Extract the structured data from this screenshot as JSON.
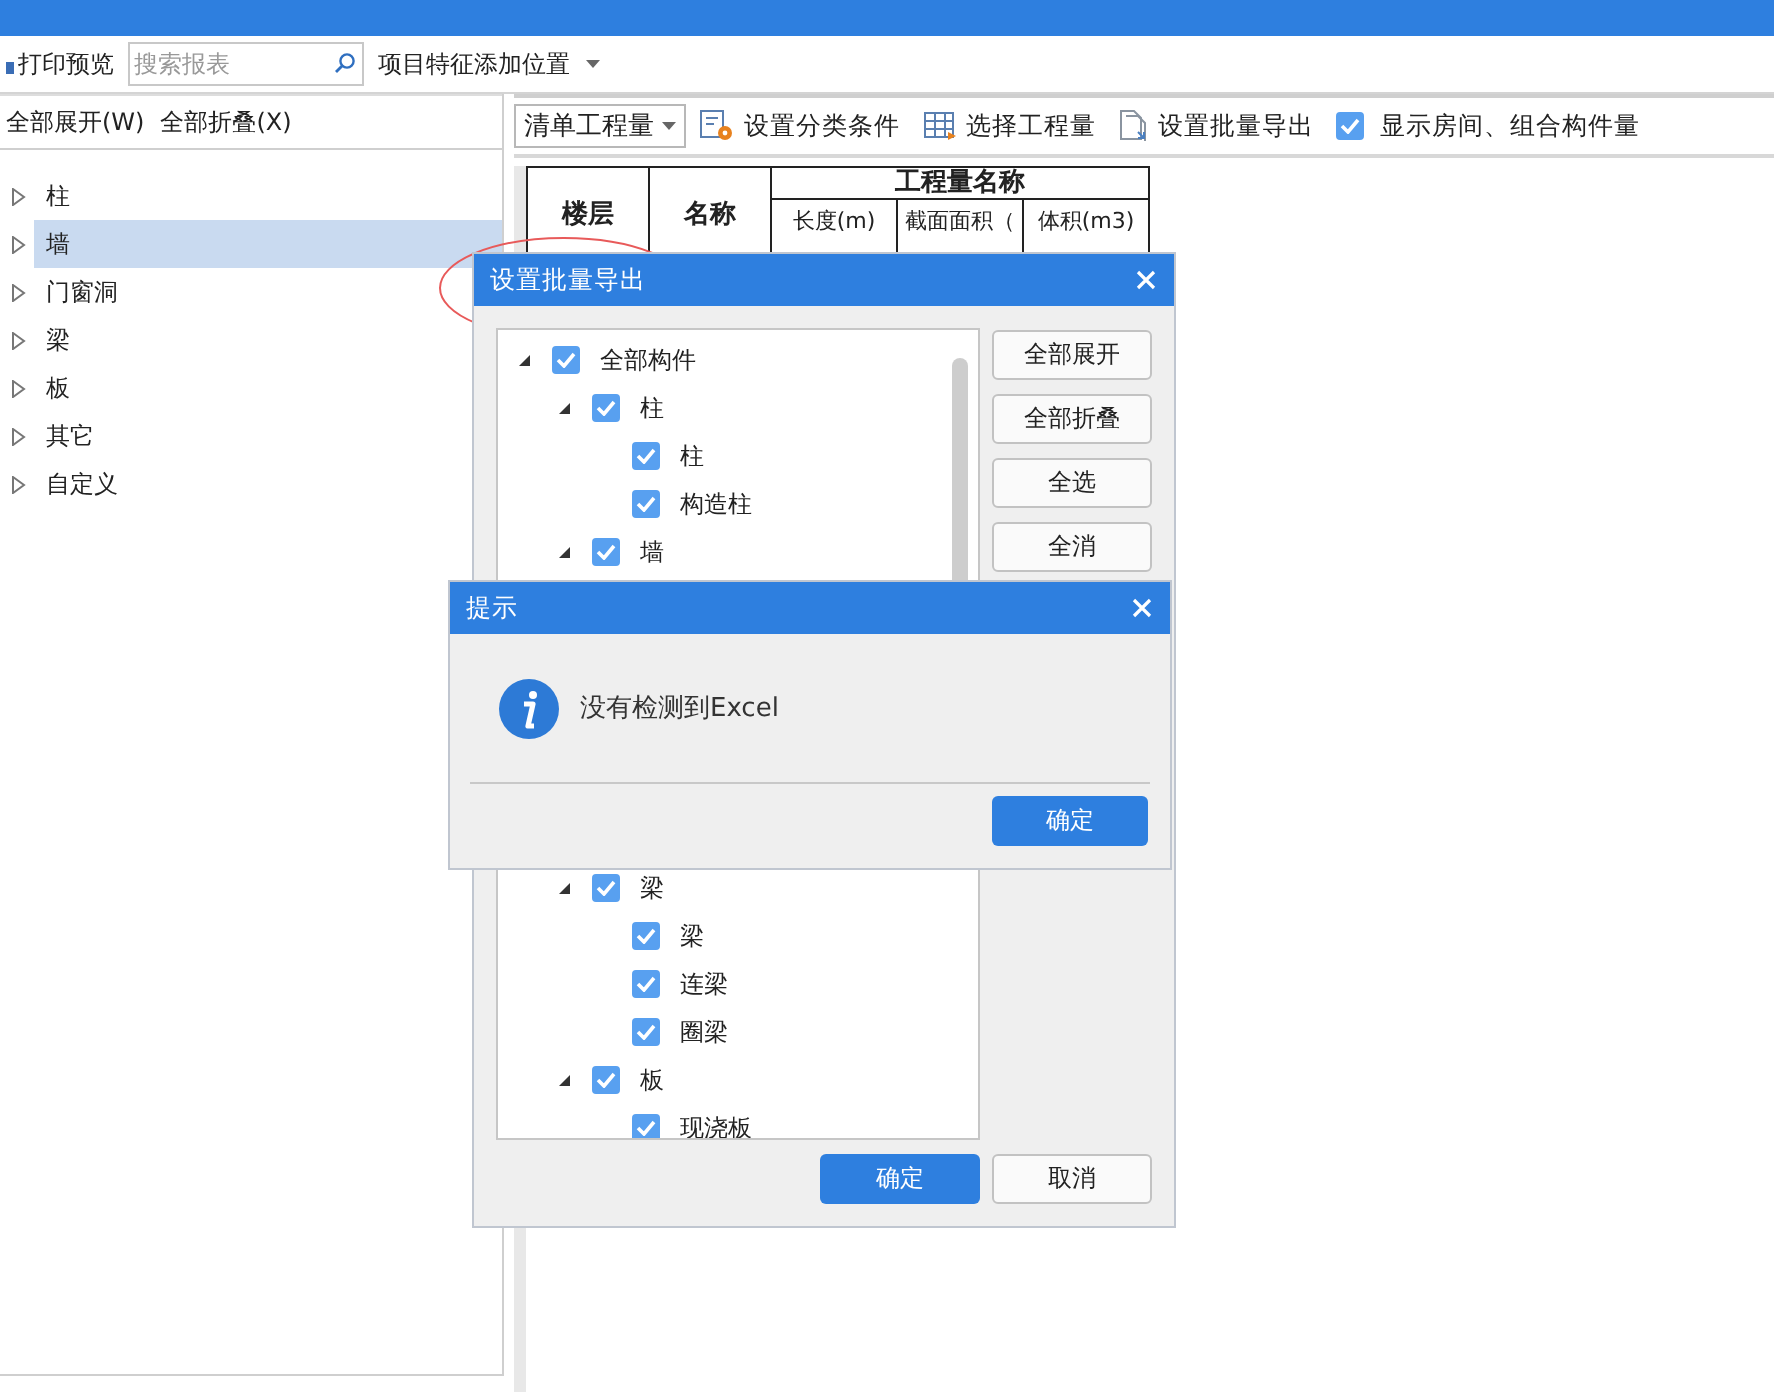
{
  "toolbar": {
    "print_preview": "打印预览",
    "search": {
      "placeholder": "搜索报表"
    },
    "feature_position": "项目特征添加位置"
  },
  "left_panel": {
    "buttons": [
      "全部展开(W)",
      "全部折叠(X)"
    ],
    "tree": [
      {
        "label": "柱",
        "selected": false,
        "expanded": false
      },
      {
        "label": "墙",
        "selected": true,
        "expanded": false
      },
      {
        "label": "门窗洞",
        "selected": false,
        "expanded": false
      },
      {
        "label": "梁",
        "selected": false,
        "expanded": false
      },
      {
        "label": "板",
        "selected": false,
        "expanded": false
      },
      {
        "label": "其它",
        "selected": false,
        "expanded": false
      },
      {
        "label": "自定义",
        "selected": false,
        "expanded": false
      }
    ]
  },
  "report_toolbar": {
    "mode": "清单工程量",
    "actions": [
      {
        "label": "设置分类条件",
        "kind": "classify"
      },
      {
        "label": "选择工程量",
        "kind": "table"
      },
      {
        "label": "设置批量导出",
        "kind": "export"
      }
    ],
    "show_rooms": {
      "label": "显示房间、组合构件量",
      "checked": true
    }
  },
  "table": {
    "floor": "楼层",
    "name": "名称",
    "group": "工程量名称",
    "columns": [
      "长度(m)",
      "截面面积（",
      "体积(m3)"
    ]
  },
  "export_dialog": {
    "title": "设置批量导出",
    "tree": [
      {
        "label": "全部构件",
        "checked": true,
        "expanded": true,
        "children": [
          {
            "label": "柱",
            "checked": true,
            "expanded": true,
            "children": [
              {
                "label": "柱",
                "checked": true
              },
              {
                "label": "构造柱",
                "checked": true
              }
            ]
          },
          {
            "label": "墙",
            "checked": true,
            "expanded": true
          },
          {
            "label": "梁",
            "checked": true,
            "expanded": true,
            "children": [
              {
                "label": "梁",
                "checked": true
              },
              {
                "label": "连梁",
                "checked": true
              },
              {
                "label": "圈梁",
                "checked": true
              }
            ]
          },
          {
            "label": "板",
            "checked": true,
            "expanded": true,
            "children": [
              {
                "label": "现浇板",
                "checked": true
              }
            ]
          }
        ]
      }
    ],
    "side_buttons": [
      "全部展开",
      "全部折叠",
      "全选",
      "全消"
    ],
    "ok": "确定",
    "cancel": "取消"
  },
  "alert": {
    "title": "提示",
    "message": "没有检测到Excel",
    "ok": "确定"
  }
}
